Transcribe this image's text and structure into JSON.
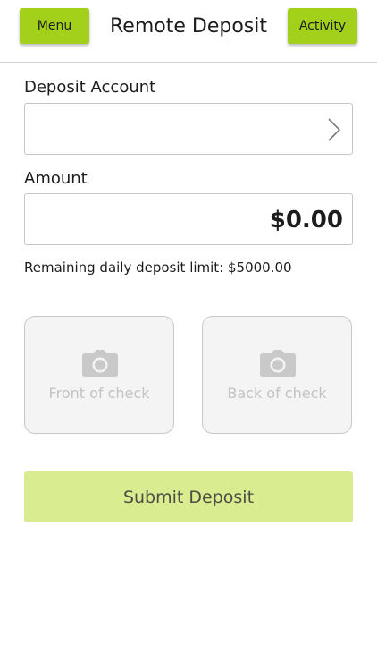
{
  "header": {
    "menu_label": "Menu",
    "title": "Remote Deposit",
    "activity_label": "Activity"
  },
  "deposit_account": {
    "label": "Deposit Account",
    "value": ""
  },
  "amount": {
    "label": "Amount",
    "value": "$0.00"
  },
  "limit_text": "Remaining daily deposit limit: $5000.00",
  "check_front": {
    "label": "Front of check",
    "icon": "camera-icon"
  },
  "check_back": {
    "label": "Back of check",
    "icon": "camera-icon"
  },
  "submit_label": "Submit Deposit",
  "colors": {
    "accent": "#a3d11b",
    "submit_disabled": "#d9ec8f",
    "tile_bg": "#f5f4f5",
    "tile_text": "#c3c3c3"
  }
}
